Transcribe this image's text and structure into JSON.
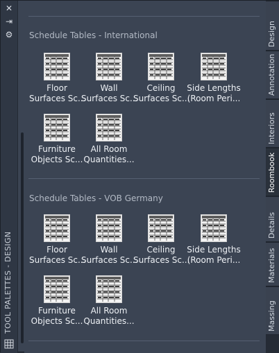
{
  "window": {
    "title": "TOOL PALETTES - DESIGN"
  },
  "strip_icons": [
    "close-icon",
    "autohide-icon",
    "properties-icon"
  ],
  "sections": [
    {
      "title": "Schedule Tables - International",
      "tools": [
        {
          "line1": "Floor",
          "line2": "Surfaces Sc..."
        },
        {
          "line1": "Wall",
          "line2": "Surfaces Sc..."
        },
        {
          "line1": "Ceiling",
          "line2": "Surfaces Sc..."
        },
        {
          "line1": "Side Lengths",
          "line2": "(Room Peri..."
        },
        {
          "line1": "Furniture",
          "line2": "Objects Sc..."
        },
        {
          "line1": "All Room",
          "line2": "Quantities..."
        }
      ]
    },
    {
      "title": "Schedule Tables - VOB Germany",
      "tools": [
        {
          "line1": "Floor",
          "line2": "Surfaces Sc..."
        },
        {
          "line1": "Wall",
          "line2": "Surfaces Sc..."
        },
        {
          "line1": "Ceiling",
          "line2": "Surfaces Sc..."
        },
        {
          "line1": "Side Lengths",
          "line2": "(Room Peri..."
        },
        {
          "line1": "Furniture",
          "line2": "Objects Sc..."
        },
        {
          "line1": "All Room",
          "line2": "Quantities..."
        }
      ]
    }
  ],
  "tabs": [
    {
      "label": "Design",
      "active": false
    },
    {
      "label": "Annotation",
      "active": false
    },
    {
      "label": "Interiors",
      "active": false
    },
    {
      "label": "Roombook",
      "active": true
    },
    {
      "label": "Details",
      "active": false
    },
    {
      "label": "Materials",
      "active": false
    },
    {
      "label": "Massing",
      "active": false
    }
  ],
  "colors": {
    "panel": "#3b4453",
    "strip": "#2f3744",
    "text": "#eef1f5",
    "section_text": "#b3bac5"
  }
}
